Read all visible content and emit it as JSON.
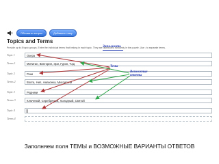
{
  "toolbar": {
    "speaker_icon": "speaker-icon",
    "buttons": [
      "Обновить вопрос",
      "Добавить тему"
    ]
  },
  "title": "Topics and Terms",
  "instructions": "Provide up to 8 topic groups. Enter the individual terms that belong in each topic. They are distributed randomly in the puzzle. Use ; to separate terms.",
  "rows": [
    {
      "label": "Topic 1",
      "value": "Озера"
    },
    {
      "label": "Terms 1",
      "value": "Мичиган, Виктория, Эри, Гурон, Чад"
    },
    {
      "label": "Topic 2",
      "value": "Реки"
    },
    {
      "label": "Terms 2",
      "value": "Волга, Нил, Амазонка, Миссисипи"
    },
    {
      "label": "Topic 3",
      "value": "Родники"
    },
    {
      "label": "Terms 3",
      "value": "Ключевой, Серебряный, Холодный, Святой"
    },
    {
      "label": "Topic 4",
      "value": ""
    },
    {
      "label": "Terms 4",
      "value": ""
    }
  ],
  "annotations": {
    "n1": "Заполнить",
    "n2": "Темы",
    "n3": "Возможные ответы"
  },
  "caption": "Заполняем поля ТЕМЫ и ВОЗМОЖНЫЕ ВАРИАНТЫ ОТВЕТОВ",
  "colors": {
    "arrow_red": "#b0383a",
    "arrow_green": "#2ea84a",
    "annotation_blue": "#1c33b0",
    "button_blue": "#2f6fd6"
  }
}
